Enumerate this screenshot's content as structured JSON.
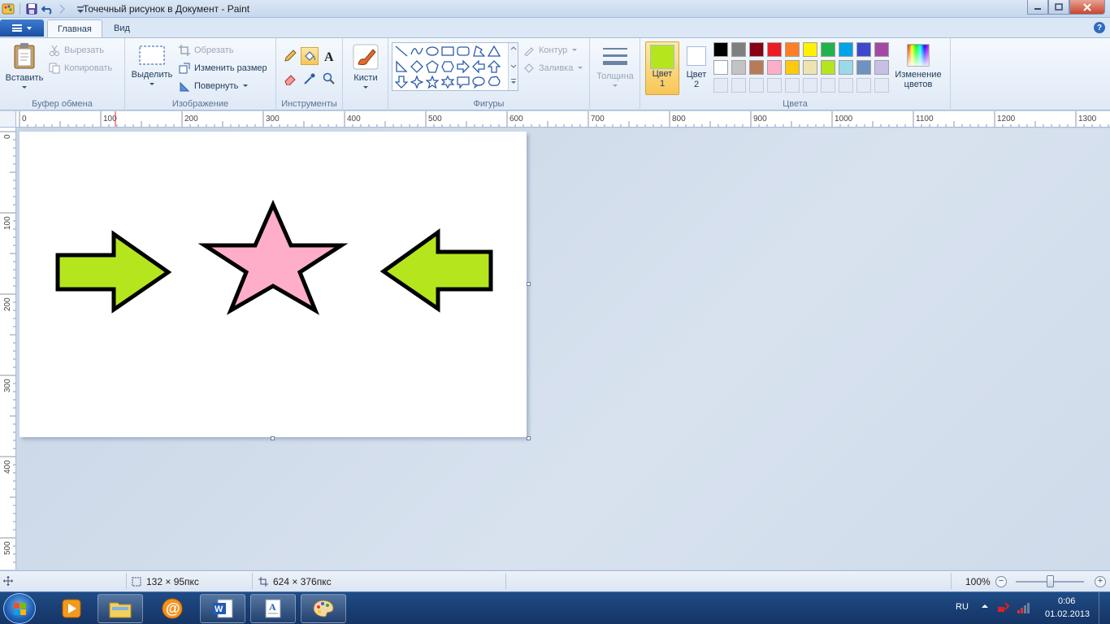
{
  "window": {
    "title": "Точечный рисунок в Документ - Paint"
  },
  "tabs": {
    "home": "Главная",
    "view": "Вид"
  },
  "ribbon": {
    "clipboard": {
      "label": "Буфер обмена",
      "paste": "Вставить",
      "cut": "Вырезать",
      "copy": "Копировать"
    },
    "image": {
      "label": "Изображение",
      "select": "Выделить",
      "crop": "Обрезать",
      "resize": "Изменить размер",
      "rotate": "Повернуть"
    },
    "tools": {
      "label": "Инструменты"
    },
    "brushes": {
      "label": "Кисти"
    },
    "shapes": {
      "label": "Фигуры",
      "outline": "Контур",
      "fill": "Заливка"
    },
    "size": {
      "label": "Толщина"
    },
    "colors": {
      "label": "Цвета",
      "color1_line1": "Цвет",
      "color1_line2": "1",
      "color2_line1": "Цвет",
      "color2_line2": "2",
      "edit_line1": "Изменение",
      "edit_line2": "цветов",
      "color1_value": "#b5e61d",
      "color2_value": "#ffffff",
      "palette_row1": [
        "#000000",
        "#7f7f7f",
        "#880015",
        "#ed1c24",
        "#ff7f27",
        "#fff200",
        "#22b14c",
        "#00a2e8",
        "#3f48cc",
        "#a349a4"
      ],
      "palette_row2": [
        "#ffffff",
        "#c3c3c3",
        "#b97a57",
        "#ffaec9",
        "#ffc90e",
        "#efe4b0",
        "#b5e61d",
        "#99d9ea",
        "#7092be",
        "#c8bfe7"
      ]
    }
  },
  "ruler": {
    "h_labels": [
      "0",
      "100",
      "200",
      "300",
      "400",
      "500",
      "600",
      "700",
      "800",
      "900",
      "1000",
      "1100",
      "1200",
      "1300"
    ],
    "v_labels": [
      "0",
      "100",
      "200",
      "300",
      "400",
      "500"
    ]
  },
  "canvas": {
    "arrow_color": "#b5e61d",
    "star_color": "#ffaec9",
    "outline_color": "#000000"
  },
  "status": {
    "selection_size": "132 × 95пкс",
    "image_size": "624 × 376пкс",
    "zoom": "100%"
  },
  "taskbar": {
    "lang": "RU",
    "time": "0:06",
    "date": "01.02.2013"
  }
}
